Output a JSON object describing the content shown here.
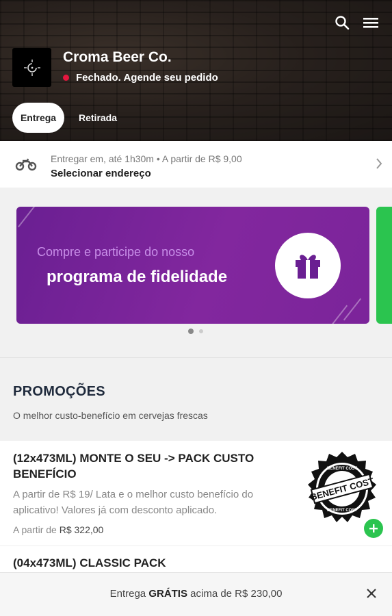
{
  "store": {
    "name": "Croma Beer Co.",
    "status": "Fechado. Agende seu pedido",
    "status_color": "#e5173f"
  },
  "tabs": [
    {
      "label": "Entrega",
      "active": true
    },
    {
      "label": "Retirada",
      "active": false
    }
  ],
  "delivery": {
    "info": "Entregar em, até 1h30m  •  A partir de R$ 9,00",
    "address_label": "Selecionar endereço"
  },
  "banner": {
    "line1": "Compre e participe do nosso",
    "line2": "programa de fidelidade",
    "bg_color": "#7b249a",
    "icon": "gift-icon"
  },
  "carousel": {
    "pages": 2,
    "current": 1
  },
  "section": {
    "title": "PROMOÇÕES",
    "subtitle": "O melhor custo-benefício em cervejas frescas"
  },
  "products": [
    {
      "title": "(12x473ML) MONTE O SEU -> PACK CUSTO BENEFÍCIO",
      "description": "A partir de R$ 19/ Lata e o melhor custo benefício do aplicativo! Valores já com desconto aplicado.",
      "price_prefix": "A partir de",
      "price": "R$ 322,00",
      "badge_text": "BENEFIT COST",
      "badge_ring_text": "BENEFIT COST"
    },
    {
      "title": "(04x473ML) CLASSIC PACK"
    }
  ],
  "bottom_bar": {
    "text_before": "Entrega ",
    "text_bold": "GRÁTIS",
    "text_after": " acima de R$ 230,00"
  },
  "colors": {
    "accent_green": "#2bc44f",
    "title_dark": "#1f2a3c"
  }
}
